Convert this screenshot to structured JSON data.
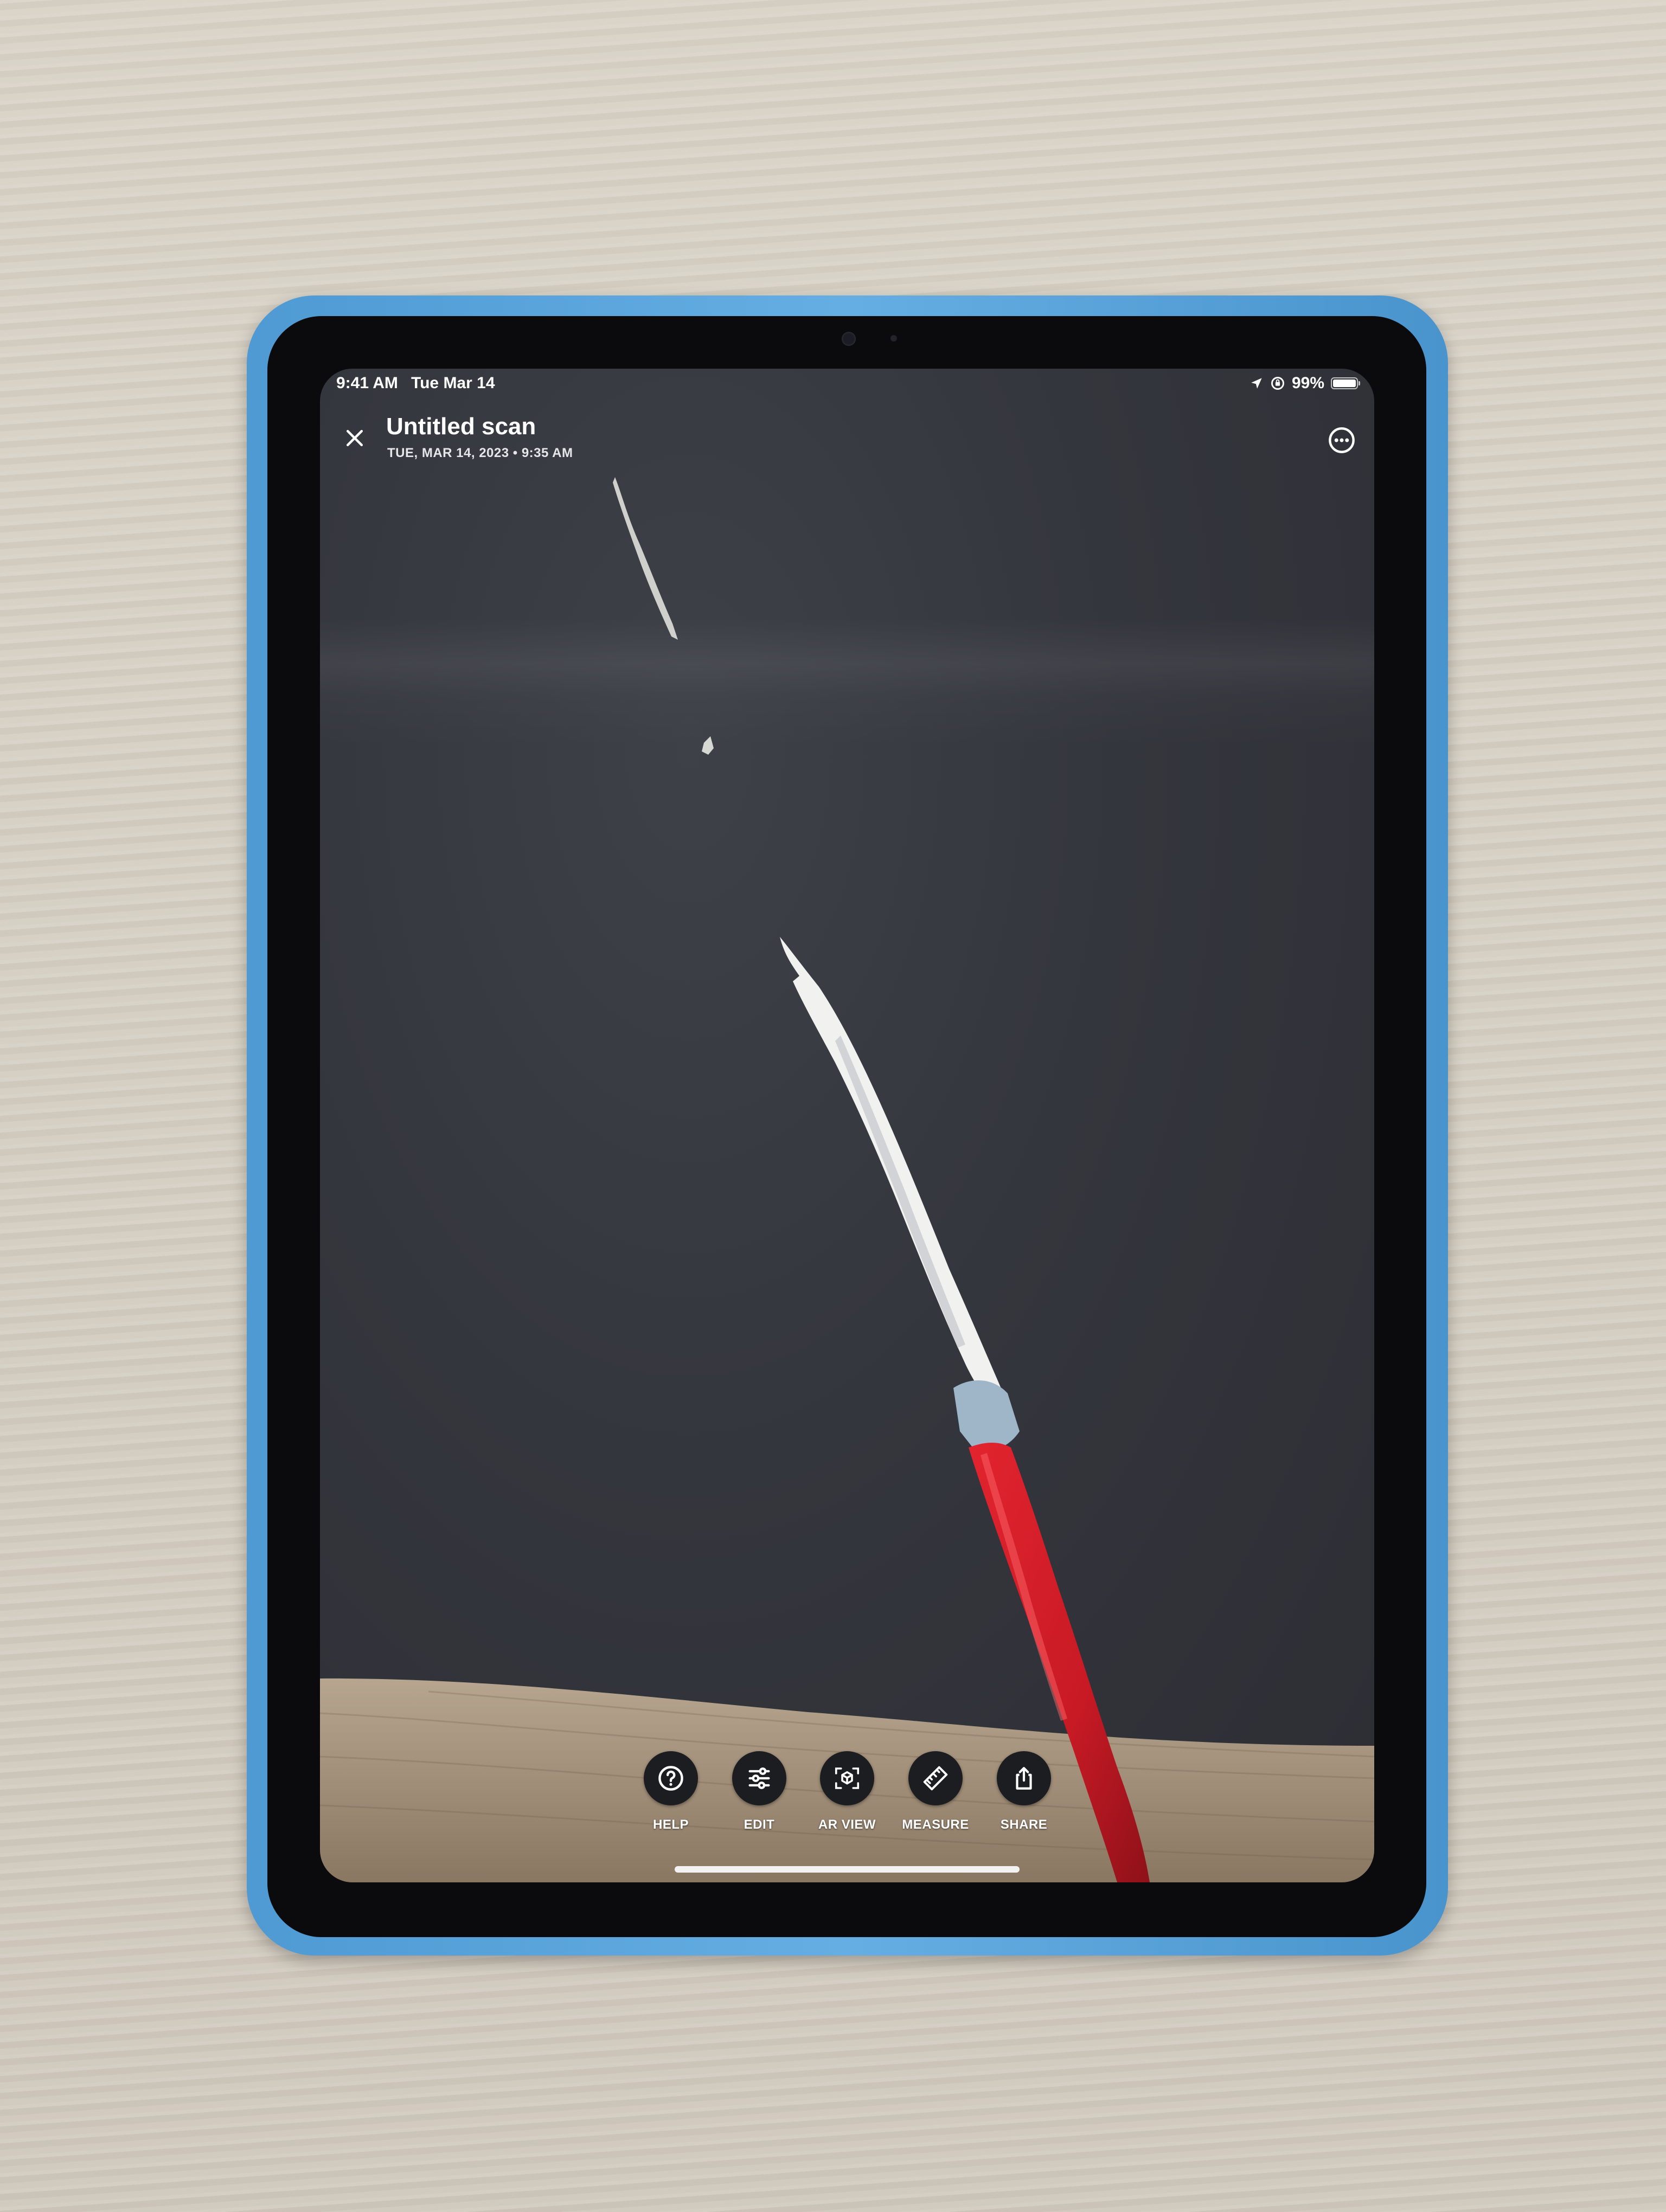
{
  "status_bar": {
    "time": "9:41 AM",
    "date": "Tue Mar 14",
    "battery": "99%",
    "battery_level": 0.99,
    "icons": [
      "location-arrow-icon",
      "screen-lock-rotation-icon",
      "battery-icon"
    ]
  },
  "header": {
    "title": "Untitled scan",
    "subtitle": "TUE, MAR 14, 2023 • 9:35 AM",
    "close_icon": "close-icon",
    "more_icon": "more-options-icon"
  },
  "toolbar": {
    "items": [
      {
        "label": "HELP",
        "icon": "help-icon"
      },
      {
        "label": "EDIT",
        "icon": "sliders-icon"
      },
      {
        "label": "AR VIEW",
        "icon": "ar-cube-icon"
      },
      {
        "label": "MEASURE",
        "icon": "ruler-icon"
      },
      {
        "label": "SHARE",
        "icon": "share-icon"
      }
    ]
  },
  "colors": {
    "case": "#5aa4dc",
    "bezel": "#0b0b0d",
    "screen_bg": "#34363d",
    "button_bg": "#1c1d21",
    "scan_red": "#d8202a",
    "scan_white": "#f4f4f2",
    "floor": "#a08e78"
  }
}
